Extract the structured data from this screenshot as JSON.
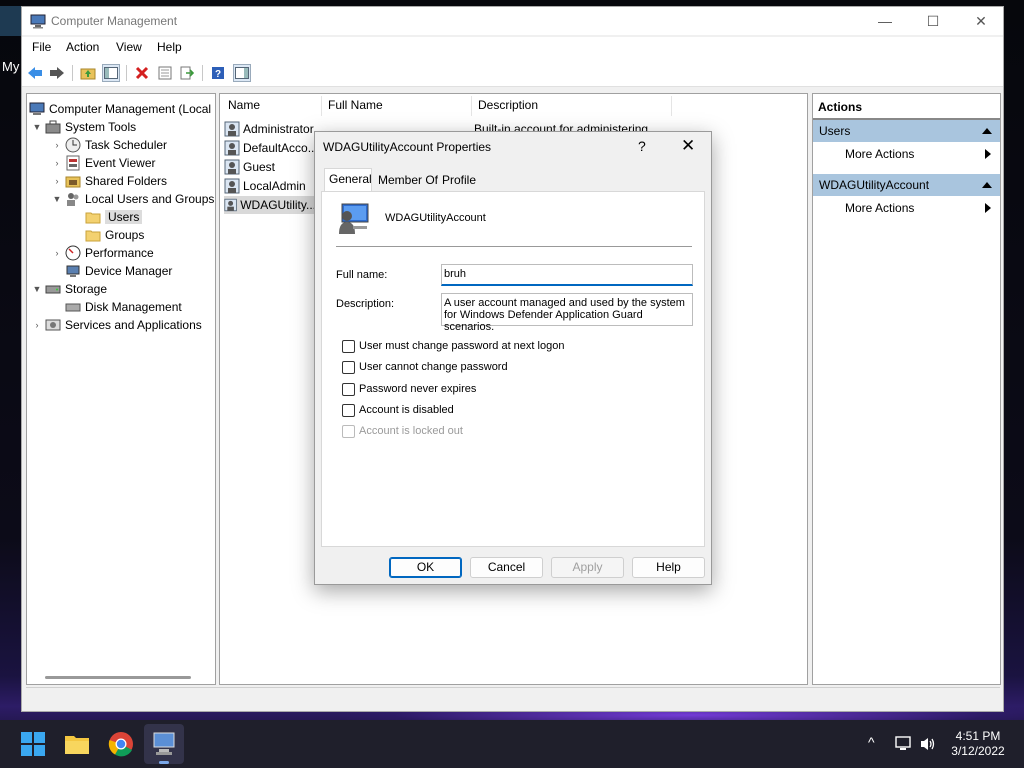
{
  "desktop": {
    "label": "My"
  },
  "window": {
    "title": "Computer Management",
    "controls": {
      "minimize": "—",
      "maximize": "☐",
      "close": "✕"
    }
  },
  "menu": [
    "File",
    "Action",
    "View",
    "Help"
  ],
  "toolbar_icons": [
    "back-arrow-icon",
    "forward-arrow-icon",
    "up-folder-icon",
    "show-hide-tree-icon",
    "delete-icon",
    "properties-icon",
    "export-icon",
    "help-icon",
    "show-action-pane-icon"
  ],
  "tree": [
    {
      "label": "Computer Management (Local"
    },
    {
      "label": "System Tools"
    },
    {
      "label": "Task Scheduler"
    },
    {
      "label": "Event Viewer"
    },
    {
      "label": "Shared Folders"
    },
    {
      "label": "Local Users and Groups"
    },
    {
      "label": "Users"
    },
    {
      "label": "Groups"
    },
    {
      "label": "Performance"
    },
    {
      "label": "Device Manager"
    },
    {
      "label": "Storage"
    },
    {
      "label": "Disk Management"
    },
    {
      "label": "Services and Applications"
    }
  ],
  "list": {
    "columns": [
      "Name",
      "Full Name",
      "Description"
    ],
    "rows": [
      {
        "name": "Administrator",
        "description": "Built-in account for administering..."
      },
      {
        "name": "DefaultAcco..."
      },
      {
        "name": "Guest"
      },
      {
        "name": "LocalAdmin"
      },
      {
        "name": "WDAGUtility..."
      }
    ]
  },
  "actions": {
    "header": "Actions",
    "sections": [
      {
        "title": "Users",
        "item": "More Actions"
      },
      {
        "title": "WDAGUtilityAccount",
        "item": "More Actions"
      }
    ]
  },
  "dialog": {
    "title": "WDAGUtilityAccount Properties",
    "help": "?",
    "close": "✕",
    "tabs": [
      "General",
      "Member Of",
      "Profile"
    ],
    "account_name": "WDAGUtilityAccount",
    "full_name_label": "Full name:",
    "full_name_value": "bruh",
    "description_label": "Description:",
    "description_value": "A user account managed and used by the system for Windows Defender Application Guard scenarios.",
    "checkboxes": [
      {
        "label": "User must change password at next logon",
        "checked": false
      },
      {
        "label": "User cannot change password",
        "checked": false
      },
      {
        "label": "Password never expires",
        "checked": false
      },
      {
        "label": "Account is disabled",
        "checked": false
      },
      {
        "label": "Account is locked out",
        "checked": false,
        "disabled": true
      }
    ],
    "buttons": {
      "ok": "OK",
      "cancel": "Cancel",
      "apply": "Apply",
      "help": "Help"
    }
  },
  "taskbar": {
    "time": "4:51 PM",
    "date": "3/12/2022"
  }
}
